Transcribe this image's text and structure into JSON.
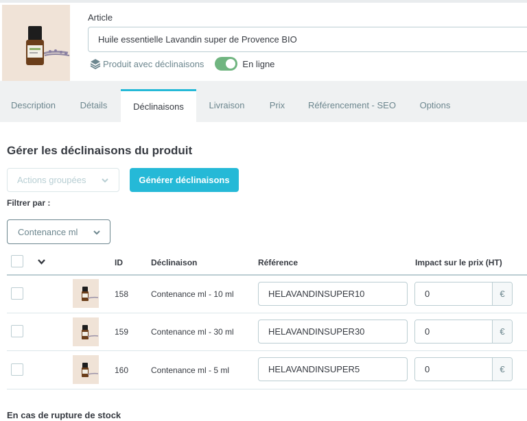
{
  "product": {
    "article_label": "Article",
    "name": "Huile essentielle Lavandin super de Provence BIO",
    "type_label": "Produit avec déclinaisons",
    "online_label": "En ligne",
    "online": true
  },
  "tabs": [
    {
      "label": "Description",
      "active": false
    },
    {
      "label": "Détails",
      "active": false
    },
    {
      "label": "Déclinaisons",
      "active": true
    },
    {
      "label": "Livraison",
      "active": false
    },
    {
      "label": "Prix",
      "active": false
    },
    {
      "label": "Référencement - SEO",
      "active": false
    },
    {
      "label": "Options",
      "active": false
    }
  ],
  "combinations": {
    "title": "Gérer les déclinaisons du produit",
    "bulk_actions_label": "Actions groupées",
    "generate_label": "Générer déclinaisons",
    "filter_label": "Filtrer par :",
    "filter_value": "Contenance ml",
    "columns": {
      "id": "ID",
      "combination": "Déclinaison",
      "reference": "Référence",
      "price_impact": "Impact sur le prix (HT)"
    },
    "currency_symbol": "€",
    "rows": [
      {
        "id": "158",
        "combination": "Contenance ml - 10 ml",
        "reference": "HELAVANDINSUPER10",
        "price_impact": "0"
      },
      {
        "id": "159",
        "combination": "Contenance ml - 30 ml",
        "reference": "HELAVANDINSUPER30",
        "price_impact": "0"
      },
      {
        "id": "160",
        "combination": "Contenance ml - 5 ml",
        "reference": "HELAVANDINSUPER5",
        "price_impact": "0"
      }
    ]
  },
  "stock": {
    "out_of_stock_title": "En cas de rupture de stock"
  },
  "colors": {
    "primary": "#25b9d7",
    "toggle_on": "#70b580",
    "tabs_bg": "#eff1f2"
  },
  "icons": {
    "layers": "layers-icon",
    "chevron": "chevron-down-icon",
    "currency": "euro-icon"
  }
}
